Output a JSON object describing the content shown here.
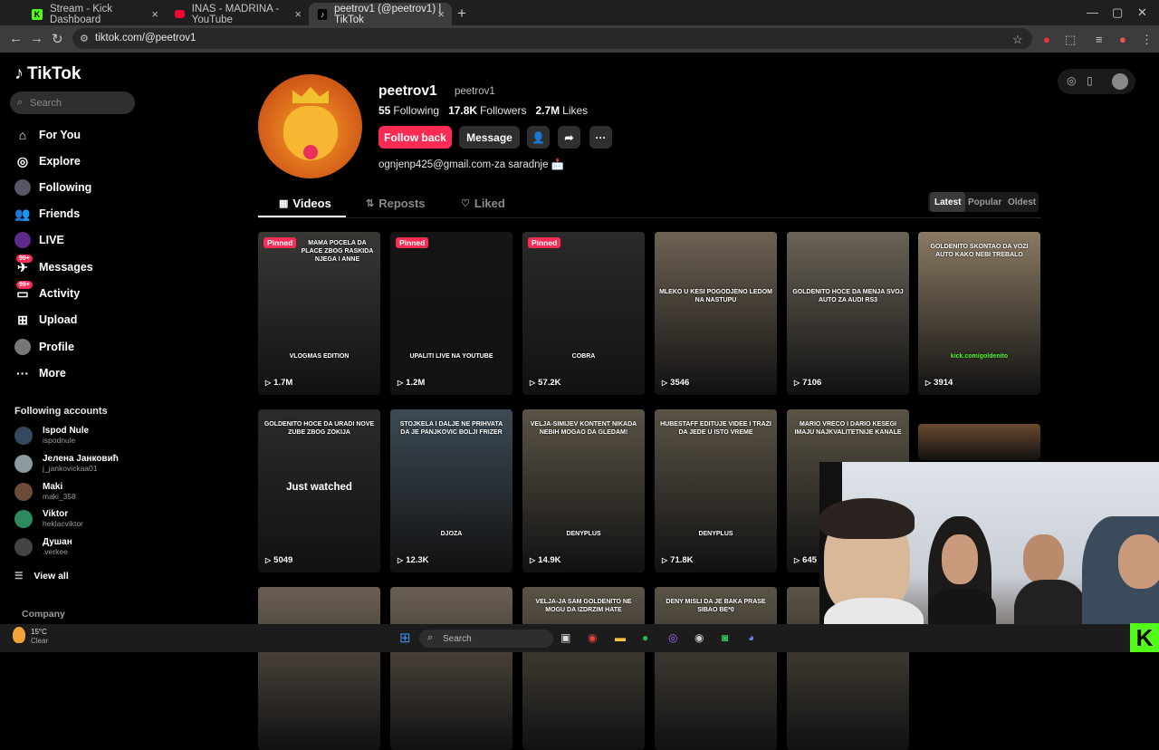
{
  "browser": {
    "tabs": [
      {
        "label": "Stream - Kick Dashboard"
      },
      {
        "label": "INAS - MADRINA - YouTube"
      },
      {
        "label": "peetrov1 (@peetrov1) | TikTok"
      }
    ],
    "url": "tiktok.com/@peetrov1"
  },
  "sidebar": {
    "logo": "TikTok",
    "search_placeholder": "Search",
    "items": [
      {
        "label": "For You",
        "icon": "home-icon"
      },
      {
        "label": "Explore",
        "icon": "compass-icon"
      },
      {
        "label": "Following",
        "icon": "following-icon"
      },
      {
        "label": "Friends",
        "icon": "friends-icon"
      },
      {
        "label": "LIVE",
        "icon": "live-icon"
      },
      {
        "label": "Messages",
        "icon": "messages-icon",
        "badge": "99+"
      },
      {
        "label": "Activity",
        "icon": "activity-icon",
        "badge": "99+"
      },
      {
        "label": "Upload",
        "icon": "upload-icon"
      },
      {
        "label": "Profile",
        "icon": "profile-icon"
      },
      {
        "label": "More",
        "icon": "more-icon"
      }
    ],
    "following_header": "Following accounts",
    "accounts": [
      {
        "name": "Ispod Nule",
        "user": "ispodnule"
      },
      {
        "name": "Јелена Јанковић",
        "user": "j_jankovickaa01"
      },
      {
        "name": "Maki",
        "user": "maki_358"
      },
      {
        "name": "Viktor",
        "user": "heklacviktor"
      },
      {
        "name": "Душан",
        "user": ".verkee"
      }
    ],
    "view_all": "View all",
    "company": "Company"
  },
  "profile": {
    "username": "peetrov1",
    "handle": "peetrov1",
    "following_count": "55",
    "following_label": "Following",
    "followers_count": "17.8K",
    "followers_label": "Followers",
    "likes_count": "2.7M",
    "likes_label": "Likes",
    "follow_back": "Follow back",
    "message": "Message",
    "bio": "ognjenp425@gmail.com-za saradnje 📩"
  },
  "tabs": {
    "videos": "Videos",
    "reposts": "Reposts",
    "liked": "Liked"
  },
  "sort": {
    "latest": "Latest",
    "popular": "Popular",
    "oldest": "Oldest"
  },
  "videos": [
    {
      "pinned": "Pinned",
      "caption": "MAMA POCELA DA PLACE ZBOG RASKIDA NJEGA I ANNE",
      "views": "1.7M",
      "bottom_caption": "VLOGMAS EDITION",
      "color": "#3a3835"
    },
    {
      "pinned": "Pinned",
      "caption": "",
      "views": "1.2M",
      "bottom_caption": "UPALITI LIVE NA YOUTUBE",
      "color": "#151515"
    },
    {
      "pinned": "Pinned",
      "caption": "",
      "views": "57.2K",
      "bottom_caption": "COBRA",
      "color": "#2a2a2a"
    },
    {
      "pinned": "",
      "caption": "MLEKO U KESI POGODJENO LEDOM NA NASTUPU",
      "views": "3546",
      "bottom_caption": "",
      "color": "#6e6253"
    },
    {
      "pinned": "",
      "caption": "GOLDENITO HOCE DA MENJA SVOJ AUTO ZA AUDI RS3",
      "views": "7106",
      "bottom_caption": "",
      "color": "#6a6357"
    },
    {
      "pinned": "",
      "caption": "GOLDENITO SKONTAO DA VOZI AUTO KAKO NEBI TREBALO",
      "views": "3914",
      "bottom_caption": "kick.com/goldenito",
      "color": "#8a7a63"
    },
    {
      "pinned": "",
      "caption": "GOLDENITO HOCE DA URADI NOVE ZUBE ZBOG ZOKIJA",
      "views": "5049",
      "overlay": "Just watched",
      "bottom_caption": "",
      "color": "#2b2b2b"
    },
    {
      "pinned": "",
      "caption": "STOJKELA I DALJE NE PRIHVATA DA JE PANJKOVIC BOLJI FRIZER",
      "views": "12.3K",
      "bottom_caption": "DJOZA",
      "color": "#3d4a55"
    },
    {
      "pinned": "",
      "caption": "VELJA-SIMIJEV KONTENT NIKADA NEBIH MOGAO DA GLEDAM!",
      "views": "14.9K",
      "bottom_caption": "DENYPLUS",
      "color": "#5a5346"
    },
    {
      "pinned": "",
      "caption": "HUBESTAFF EDITUJE VIDEE I TRAZI DA JEDE U ISTO VREME",
      "views": "71.8K",
      "bottom_caption": "DENYPLUS",
      "color": "#5a5346"
    },
    {
      "pinned": "",
      "caption": "MARIO VRECO I DARIO KESEGI IMAJU NAJKVALITETNIJE KANALE",
      "views": "645",
      "bottom_caption": "",
      "color": "#5a5346"
    },
    {
      "pinned": "",
      "caption": "",
      "views": "",
      "bottom_caption": "",
      "color": "#6b4a2f"
    },
    {
      "pinned": "",
      "caption": "",
      "views": "",
      "bottom_caption": "",
      "color": "#6a5f52"
    },
    {
      "pinned": "",
      "caption": "",
      "views": "",
      "bottom_caption": "",
      "color": "#6a5f52"
    },
    {
      "pinned": "",
      "caption": "VELJA-JA SAM GOLDENITO NE MOGU DA IZDRZIM HATE",
      "views": "",
      "bottom_caption": "",
      "color": "#5a5346"
    },
    {
      "pinned": "",
      "caption": "DENY MISLI DA JE BAKA PRASE SIBAO BE*0",
      "views": "",
      "bottom_caption": "",
      "color": "#5a5346"
    },
    {
      "pinned": "",
      "caption": "",
      "views": "",
      "bottom_caption": "",
      "color": "#5a5346"
    }
  ],
  "taskbar": {
    "temp": "15°C",
    "weather": "Clear",
    "search": "Search"
  },
  "colors": {
    "accent": "#fe2c55",
    "kick": "#53fc18"
  }
}
